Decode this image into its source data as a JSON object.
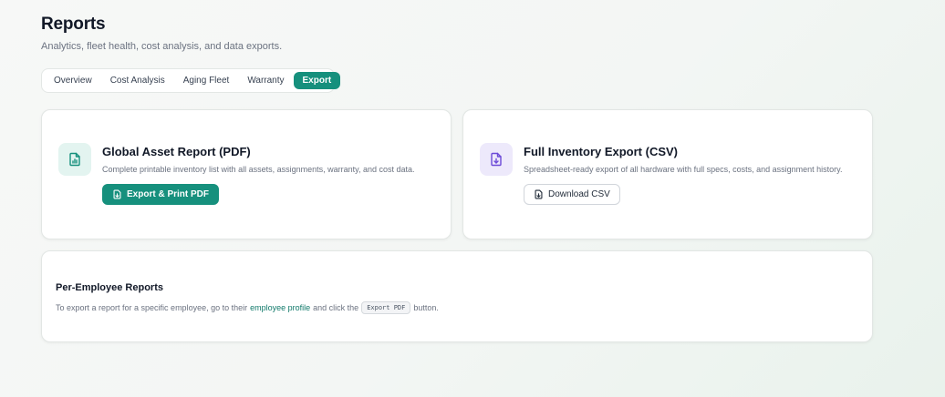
{
  "header": {
    "title": "Reports",
    "subtitle": "Analytics, fleet health, cost analysis, and data exports."
  },
  "tabs": [
    {
      "label": "Overview",
      "active": false
    },
    {
      "label": "Cost Analysis",
      "active": false
    },
    {
      "label": "Aging Fleet",
      "active": false
    },
    {
      "label": "Warranty",
      "active": false
    },
    {
      "label": "Export",
      "active": true
    }
  ],
  "pdf_card": {
    "icon": "chart-document-icon",
    "title": "Global Asset Report (PDF)",
    "description": "Complete printable inventory list with all assets, assignments, warranty, and cost data.",
    "button_label": "Export & Print PDF"
  },
  "csv_card": {
    "icon": "download-document-icon",
    "title": "Full Inventory Export (CSV)",
    "description": "Spreadsheet-ready export of all hardware with full specs, costs, and assignment history.",
    "button_label": "Download CSV"
  },
  "employee_card": {
    "title": "Per-Employee Reports",
    "text_before": "To export a report for a specific employee, go to their",
    "link_text": "employee profile",
    "text_middle": "and click the",
    "code_chip": "Export PDF",
    "text_after": "button."
  },
  "colors": {
    "accent": "#16907d",
    "purple_icon": "#6d4bd8",
    "link": "#127a6b"
  }
}
